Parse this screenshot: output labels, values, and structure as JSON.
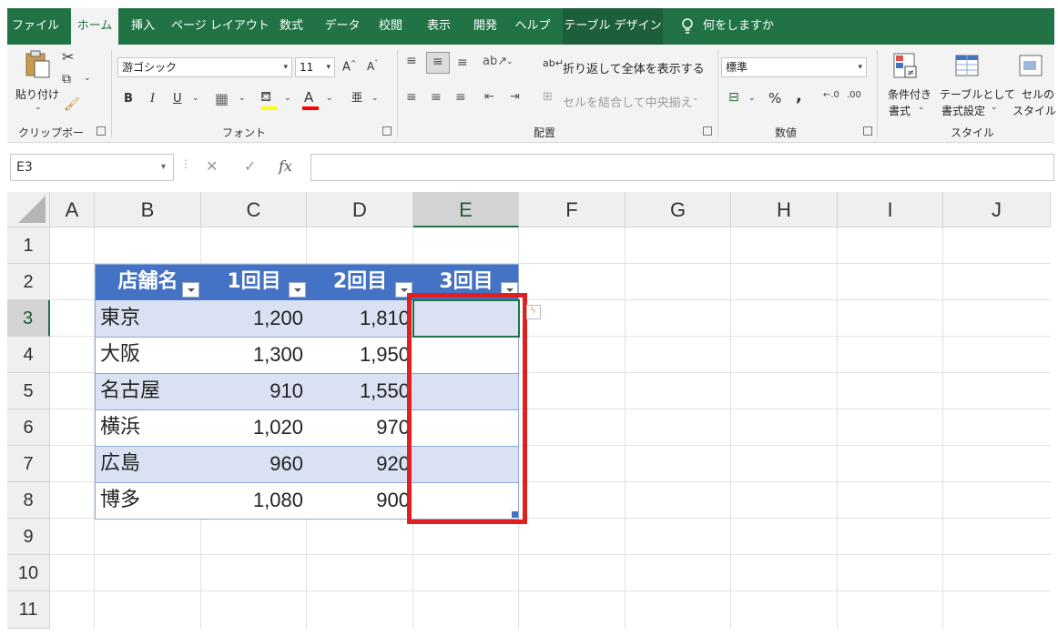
{
  "ribbon": {
    "tabs": [
      "ファイル",
      "ホーム",
      "挿入",
      "ページ レイアウト",
      "数式",
      "データ",
      "校閲",
      "表示",
      "開発",
      "ヘルプ",
      "テーブル デザイン"
    ],
    "active_tab": "ホーム",
    "tell_me": "何をしますか",
    "clipboard": {
      "paste": "貼り付け",
      "group": "クリップボード"
    },
    "font": {
      "name": "游ゴシック",
      "size": "11",
      "group": "フォント",
      "bold": "B",
      "italic": "I",
      "underline": "U",
      "highlight_color": "#ffff00",
      "font_color": "#ff0000"
    },
    "alignment": {
      "wrap": "折り返して全体を表示する",
      "merge": "セルを結合して中央揃え",
      "group": "配置"
    },
    "number": {
      "format": "標準",
      "percent": "%",
      "comma": ",",
      "group": "数値"
    },
    "styles": {
      "conditional": [
        "条件付き",
        "書式"
      ],
      "table": [
        "テーブルとして",
        "書式設定"
      ],
      "cell": [
        "セルの",
        "スタイル"
      ],
      "group": "スタイル"
    }
  },
  "formula_bar": {
    "name_box": "E3",
    "fx": "fx",
    "value": ""
  },
  "grid": {
    "columns": [
      "A",
      "B",
      "C",
      "D",
      "E",
      "F",
      "G",
      "H",
      "I",
      "J"
    ],
    "rows": [
      "1",
      "2",
      "3",
      "4",
      "5",
      "6",
      "7",
      "8",
      "9",
      "10",
      "11"
    ],
    "selected_column": "E",
    "selected_row": "3"
  },
  "table": {
    "headers": [
      "店舗名",
      "1回目",
      "2回目",
      "3回目"
    ],
    "rows": [
      [
        "東京",
        "1,200",
        "1,810",
        ""
      ],
      [
        "大阪",
        "1,300",
        "1,950",
        ""
      ],
      [
        "名古屋",
        "910",
        "1,550",
        ""
      ],
      [
        "横浜",
        "1,020",
        "970",
        ""
      ],
      [
        "広島",
        "960",
        "920",
        ""
      ],
      [
        "博多",
        "1,080",
        "900",
        ""
      ]
    ],
    "header_color": "#4472c4",
    "band_color": "#d9e1f2"
  },
  "highlight_color": "#e21f1f"
}
